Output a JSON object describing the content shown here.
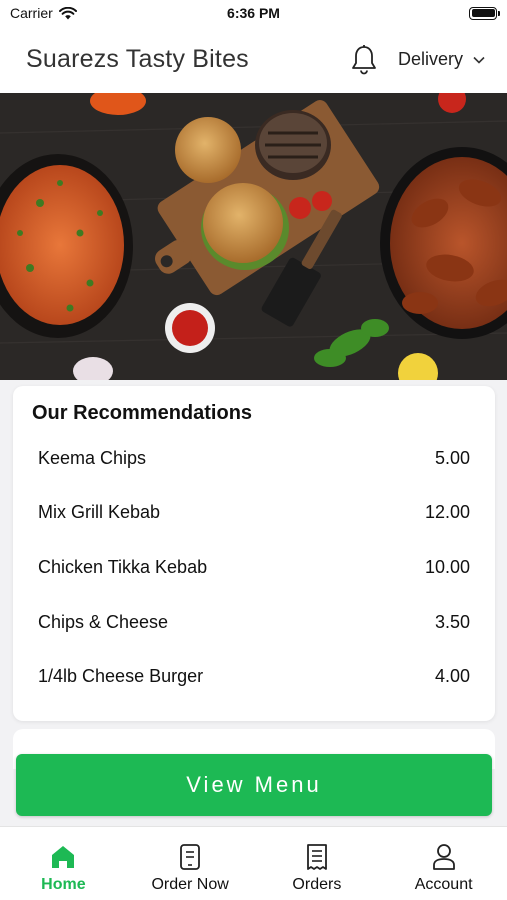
{
  "status_bar": {
    "carrier": "Carrier",
    "time": "6:36 PM"
  },
  "header": {
    "title": "Suarezs Tasty Bites",
    "mode": "Delivery"
  },
  "recommendations": {
    "title": "Our Recommendations",
    "items": [
      {
        "name": "Keema Chips",
        "price": "5.00"
      },
      {
        "name": "Mix Grill Kebab",
        "price": "12.00"
      },
      {
        "name": "Chicken Tikka Kebab",
        "price": "10.00"
      },
      {
        "name": "Chips & Cheese",
        "price": "3.50"
      },
      {
        "name": "1/4lb Cheese Burger",
        "price": "4.00"
      }
    ]
  },
  "view_menu_label": "View Menu",
  "tabs": [
    {
      "label": "Home",
      "icon": "home-icon"
    },
    {
      "label": "Order Now",
      "icon": "order-icon"
    },
    {
      "label": "Orders",
      "icon": "receipt-icon"
    },
    {
      "label": "Account",
      "icon": "user-icon"
    }
  ],
  "colors": {
    "accent": "#1db954",
    "hero_bg": "#2a2726"
  }
}
